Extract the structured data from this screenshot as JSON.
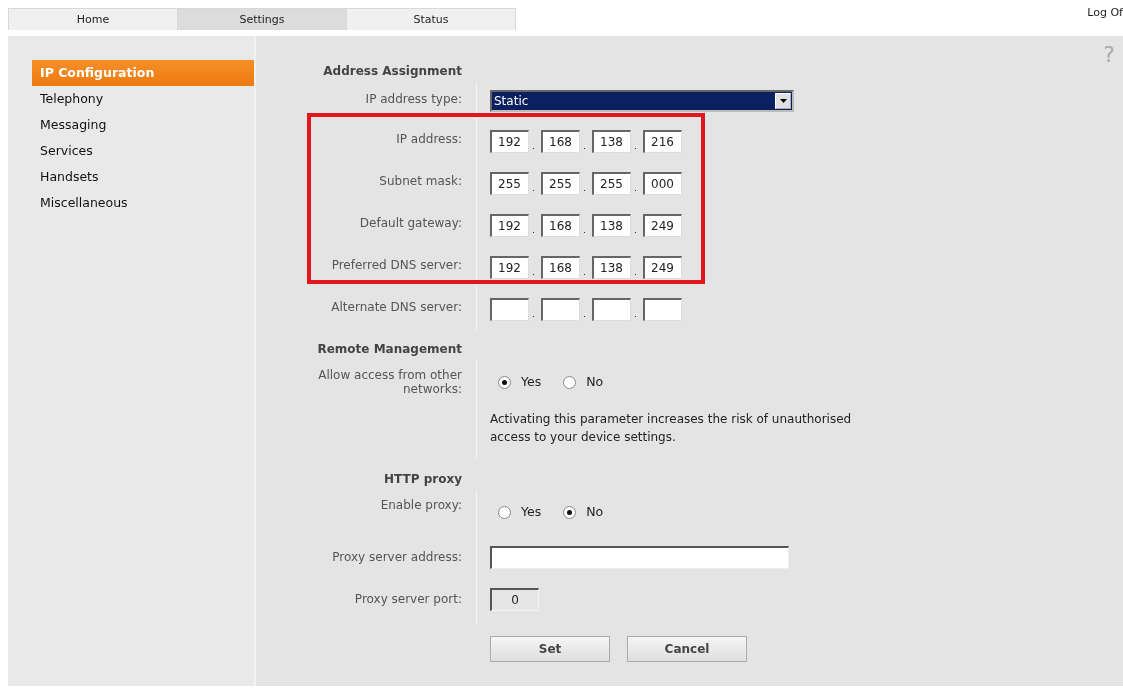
{
  "tabs": [
    {
      "label": "Home",
      "selected": false
    },
    {
      "label": "Settings",
      "selected": true
    },
    {
      "label": "Status",
      "selected": false
    }
  ],
  "logoff": "Log Of",
  "help": "?",
  "sidebar": {
    "items": [
      {
        "label": "IP Configuration",
        "selected": true
      },
      {
        "label": "Telephony",
        "selected": false
      },
      {
        "label": "Messaging",
        "selected": false
      },
      {
        "label": "Services",
        "selected": false
      },
      {
        "label": "Handsets",
        "selected": false
      },
      {
        "label": "Miscellaneous",
        "selected": false
      }
    ]
  },
  "sections": [
    {
      "heading": "Address Assignment",
      "fields": [
        {
          "kind": "select",
          "label": "IP address type:",
          "value": "Static",
          "highlighted": false
        },
        {
          "kind": "ip",
          "label": "IP address:",
          "octets": [
            {
              "value": "192"
            },
            {
              "value": "168"
            },
            {
              "value": "138"
            },
            {
              "value": "216"
            }
          ],
          "highlighted": true
        },
        {
          "kind": "ip",
          "label": "Subnet mask:",
          "octets": [
            {
              "value": "255"
            },
            {
              "value": "255"
            },
            {
              "value": "255"
            },
            {
              "value": "000"
            }
          ],
          "highlighted": true
        },
        {
          "kind": "ip",
          "label": "Default gateway:",
          "octets": [
            {
              "value": "192"
            },
            {
              "value": "168"
            },
            {
              "value": "138"
            },
            {
              "value": "249"
            }
          ],
          "highlighted": true
        },
        {
          "kind": "ip",
          "label": "Preferred DNS server:",
          "octets": [
            {
              "value": "192"
            },
            {
              "value": "168"
            },
            {
              "value": "138"
            },
            {
              "value": "249"
            }
          ],
          "highlighted": true
        },
        {
          "kind": "ip",
          "label": "Alternate DNS server:",
          "highlighted": false
        }
      ]
    },
    {
      "heading": "Remote Management",
      "fields": [
        {
          "kind": "radio",
          "label": "Allow access from other networks:",
          "options": [
            {
              "label": "Yes",
              "selected": true
            },
            {
              "label": "No",
              "selected": false
            }
          ],
          "highlighted": false
        },
        {
          "kind": "note",
          "text": "Activating this parameter increases the risk of unauthorised access to your device settings.",
          "highlighted": false
        }
      ]
    },
    {
      "heading": "HTTP proxy",
      "fields": [
        {
          "kind": "radio",
          "label": "Enable proxy:",
          "options": [
            {
              "label": "Yes",
              "selected": false
            },
            {
              "label": "No",
              "selected": true
            }
          ],
          "highlighted": false
        },
        {
          "kind": "text",
          "label": "Proxy server address:",
          "highlighted": false
        },
        {
          "kind": "port",
          "label": "Proxy server port:",
          "value": "0",
          "highlighted": false
        }
      ]
    }
  ],
  "buttons": [
    "Set",
    "Cancel"
  ]
}
